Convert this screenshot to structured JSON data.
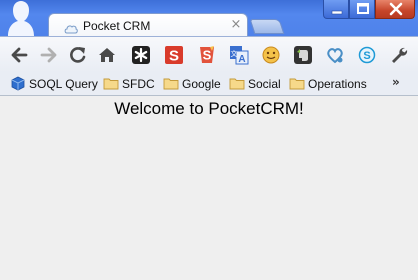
{
  "tab": {
    "title": "Pocket CRM",
    "close_glyph": "×",
    "favicon": "cloud-icon"
  },
  "window_controls": [
    "minimize-icon",
    "maximize-icon",
    "close-window-icon"
  ],
  "toolbar": {
    "buttons": [
      {
        "name": "back",
        "icon": "arrow-left-icon"
      },
      {
        "name": "forward",
        "icon": "arrow-right-icon"
      },
      {
        "name": "reload",
        "icon": "reload-icon"
      },
      {
        "name": "home",
        "icon": "home-icon"
      }
    ],
    "extensions": [
      {
        "name": "asterisk-extension",
        "icon": "asterisk-icon",
        "glyph": "✱",
        "color": "#222222"
      },
      {
        "name": "s-red-extension",
        "icon": "s-red-icon",
        "glyph": "S",
        "color": "#d93b2b"
      },
      {
        "name": "s-lightning-extension",
        "icon": "s-lightning-icon",
        "glyph": "S",
        "color": "#e2533c"
      },
      {
        "name": "translate-extension",
        "icon": "translate-icon",
        "glyph": "A",
        "color": "#3a6fcf"
      },
      {
        "name": "smiley-extension",
        "icon": "smiley-icon",
        "glyph": "",
        "color": "#f0b43c"
      },
      {
        "name": "evernote-extension",
        "icon": "elephant-icon",
        "glyph": "",
        "color": "#333333"
      },
      {
        "name": "heart-extension",
        "icon": "heart-icon",
        "glyph": "",
        "color": "#4a8fc6"
      },
      {
        "name": "skype-extension",
        "icon": "skype-icon",
        "glyph": "S",
        "color": "#1e9ad6"
      }
    ],
    "wrench_icon": "wrench-icon"
  },
  "bookmarks": [
    {
      "label": "SOQL Query",
      "icon": "cube-icon"
    },
    {
      "label": "SFDC",
      "icon": "folder-icon"
    },
    {
      "label": "Google",
      "icon": "folder-icon"
    },
    {
      "label": "Social",
      "icon": "folder-icon"
    },
    {
      "label": "Operations",
      "icon": "folder-icon"
    }
  ],
  "bookmarks_overflow": "»",
  "page": {
    "heading": "Welcome to PocketCRM!"
  }
}
